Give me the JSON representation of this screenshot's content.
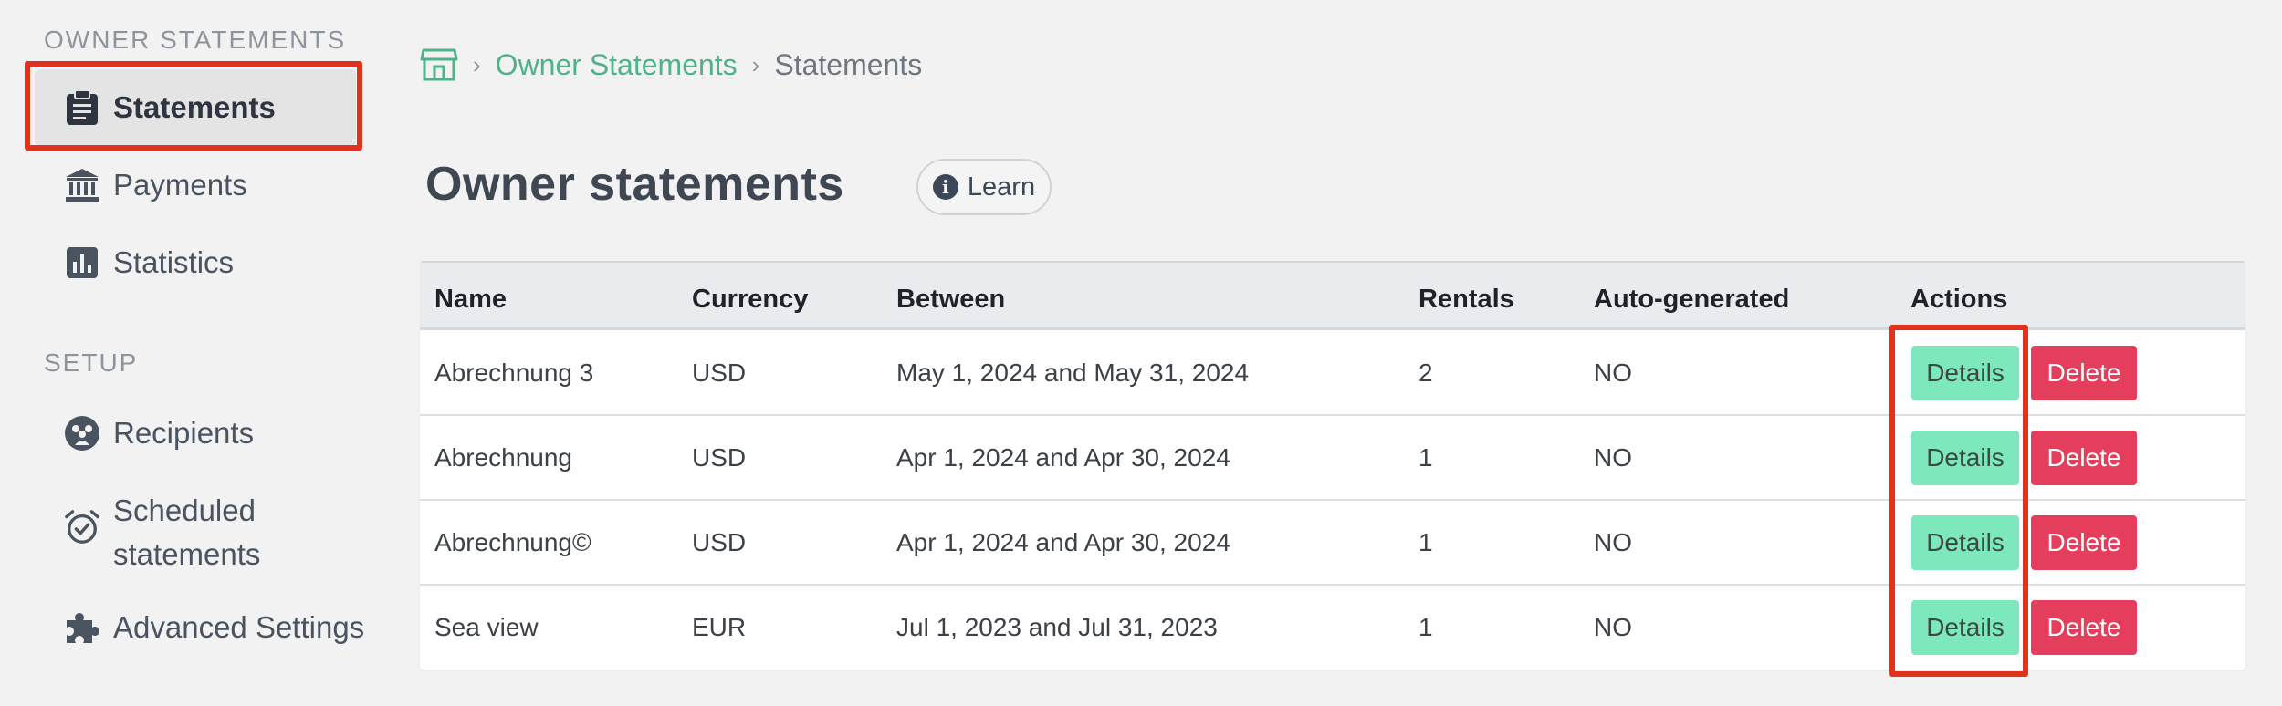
{
  "sidebar": {
    "sections": [
      {
        "title": "OWNER STATEMENTS"
      },
      {
        "title": "SETUP"
      }
    ],
    "items": [
      {
        "label": "Statements",
        "icon": "clipboard-icon",
        "active": true
      },
      {
        "label": "Payments",
        "icon": "bank-icon"
      },
      {
        "label": "Statistics",
        "icon": "bar-chart-icon"
      },
      {
        "label": "Recipients",
        "icon": "users-icon"
      },
      {
        "label": "Scheduled",
        "label2": "statements",
        "icon": "alarm-clock-icon"
      },
      {
        "label": "Advanced Settings",
        "icon": "puzzle-icon"
      }
    ]
  },
  "breadcrumb": {
    "home_icon": "store-icon",
    "link": "Owner Statements",
    "current": "Statements"
  },
  "page": {
    "title": "Owner statements",
    "learn_label": "Learn",
    "learn_icon_glyph": "i"
  },
  "table": {
    "headers": [
      "Name",
      "Currency",
      "Between",
      "Rentals",
      "Auto-generated",
      "Actions"
    ],
    "rows": [
      {
        "name": "Abrechnung 3",
        "currency": "USD",
        "between": "May 1, 2024 and May 31, 2024",
        "rentals": "2",
        "auto": "NO",
        "details": "Details",
        "delete": "Delete"
      },
      {
        "name": "Abrechnung",
        "currency": "USD",
        "between": "Apr 1, 2024 and Apr 30, 2024",
        "rentals": "1",
        "auto": "NO",
        "details": "Details",
        "delete": "Delete"
      },
      {
        "name": "Abrechnung©",
        "currency": "USD",
        "between": "Apr 1, 2024 and Apr 30, 2024",
        "rentals": "1",
        "auto": "NO",
        "details": "Details",
        "delete": "Delete"
      },
      {
        "name": "Sea view",
        "currency": "EUR",
        "between": "Jul 1, 2023 and Jul 31, 2023",
        "rentals": "1",
        "auto": "NO",
        "details": "Details",
        "delete": "Delete"
      }
    ]
  },
  "colors": {
    "accent_green": "#4fb38a",
    "details_button": "#7ee8bd",
    "delete_button": "#e53e5c",
    "highlight_box": "#e0321c"
  }
}
